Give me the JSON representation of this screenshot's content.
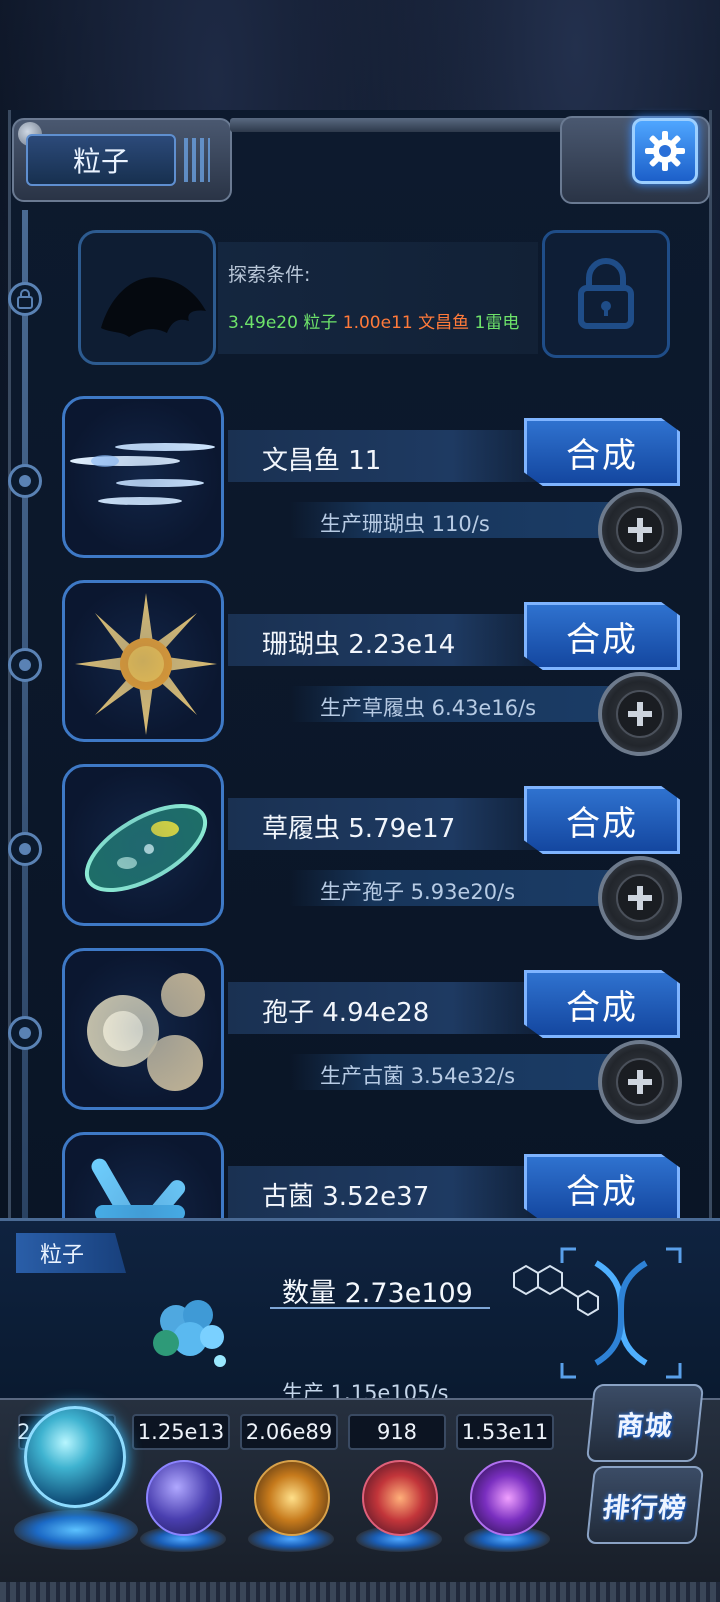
{
  "header": {
    "title": "粒子"
  },
  "locked_entry": {
    "caption": "探索条件:",
    "requirements": [
      {
        "text": "3.49e20 粒子",
        "color": "#6ee36a"
      },
      {
        "text": "1.00e11 文昌鱼",
        "color": "#ff7a3a"
      },
      {
        "text": "1雷电",
        "color": "#6ee36a"
      }
    ]
  },
  "creatures": [
    {
      "name": "文昌鱼 11",
      "production": "生产珊瑚虫 110/s",
      "merge_label": "合成",
      "icon": "lancelet-fish-icon"
    },
    {
      "name": "珊瑚虫 2.23e14",
      "production": "生产草履虫 6.43e16/s",
      "merge_label": "合成",
      "icon": "coral-polyp-icon"
    },
    {
      "name": "草履虫 5.79e17",
      "production": "生产孢子 5.93e20/s",
      "merge_label": "合成",
      "icon": "paramecium-icon"
    },
    {
      "name": "孢子 4.94e28",
      "production": "生产古菌 3.54e32/s",
      "merge_label": "合成",
      "icon": "spore-icon"
    },
    {
      "name": "古菌 3.52e37",
      "production": "",
      "merge_label": "合成",
      "icon": "archaea-icon"
    }
  ],
  "status": {
    "tag": "粒子",
    "count": "数量 2.73e109",
    "production": "生产 1.15e105/s"
  },
  "resources": [
    {
      "value": "2.73e109",
      "icon": "atom-orb-icon"
    },
    {
      "value": "1.25e13",
      "icon": "lightning-orb-icon"
    },
    {
      "value": "2.06e89",
      "icon": "nebula-orb-icon"
    },
    {
      "value": "918",
      "icon": "brain-orb-icon"
    },
    {
      "value": "1.53e11",
      "icon": "vortex-orb-icon"
    }
  ],
  "side_buttons": {
    "shop": "商城",
    "leaderboard": "排行榜"
  },
  "colors": {
    "accent": "#2f72cf",
    "gear": "#4fa6ff",
    "green": "#6ee36a",
    "orange": "#ff7a3a"
  }
}
